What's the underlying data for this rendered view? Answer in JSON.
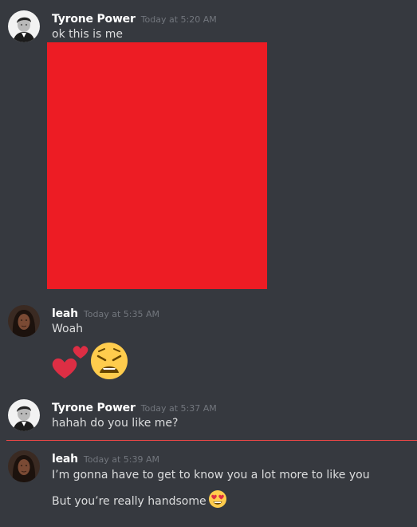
{
  "messages": [
    {
      "author": "Tyrone Power",
      "timestamp": "Today at 5:20 AM",
      "lines": [
        "ok this is me"
      ],
      "attachment": "image"
    },
    {
      "author": "leah",
      "timestamp": "Today at 5:35 AM",
      "lines": [
        "Woah"
      ],
      "emojis": [
        "two-hearts-icon",
        "weary-face-icon"
      ]
    },
    {
      "author": "Tyrone Power",
      "timestamp": "Today at 5:37 AM",
      "lines": [
        "hahah do you like me?"
      ]
    },
    {
      "author": "leah",
      "timestamp": "Today at 5:39 AM",
      "lines": [
        "I’m gonna have to get to know you a lot more to like you",
        "But you’re really handsome"
      ],
      "inline_emoji": "heart-eyes-face-icon"
    }
  ],
  "colors": {
    "background": "#36393f",
    "username": "#ffffff",
    "timestamp": "#72767d",
    "message_text": "#dcddde",
    "redaction": "#ed1c24",
    "new_messages_divider": "#f04747"
  }
}
